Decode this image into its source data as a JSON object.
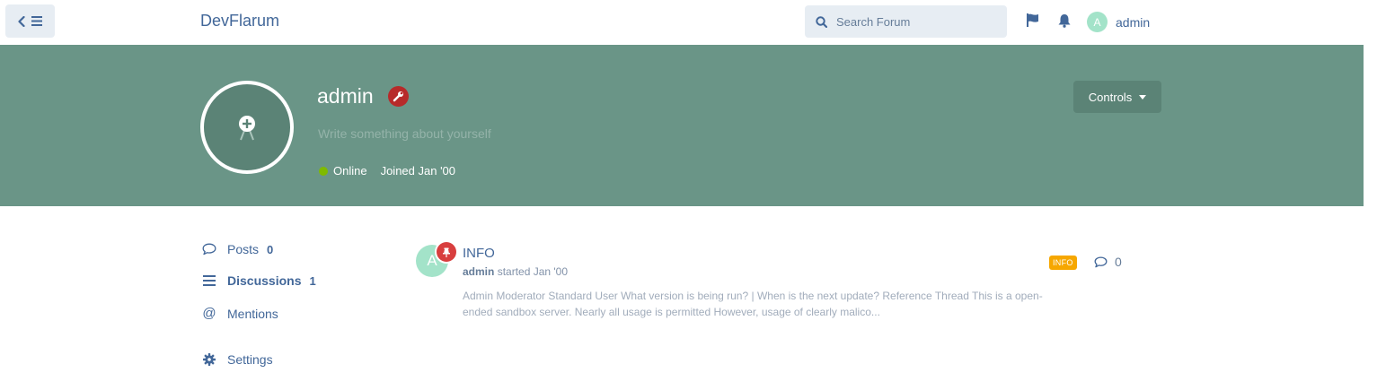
{
  "header": {
    "forum_title": "DevFlarum",
    "search_placeholder": "Search Forum",
    "username": "admin",
    "avatar_letter": "A"
  },
  "profile": {
    "username": "admin",
    "bio_placeholder": "Write something about yourself",
    "status": "Online",
    "joined": "Joined Jan '00",
    "controls_label": "Controls"
  },
  "nav": {
    "posts_label": "Posts",
    "posts_count": "0",
    "discussions_label": "Discussions",
    "discussions_count": "1",
    "mentions_label": "Mentions",
    "settings_label": "Settings"
  },
  "discussion": {
    "avatar_letter": "A",
    "title": "INFO",
    "author": "admin",
    "started": "started Jan '00",
    "excerpt": "Admin Moderator Standard User What version is being run? | When is the next update? Reference Thread This is a open-ended sandbox server. Nearly all usage is permitted However, usage of clearly malico...",
    "tag": "INFO",
    "reply_count": "0"
  },
  "colors": {
    "hero": "#6a9587",
    "accent": "#426799",
    "tag": "#f6a700",
    "badge": "#b72a2a",
    "online": "#7fba00"
  }
}
